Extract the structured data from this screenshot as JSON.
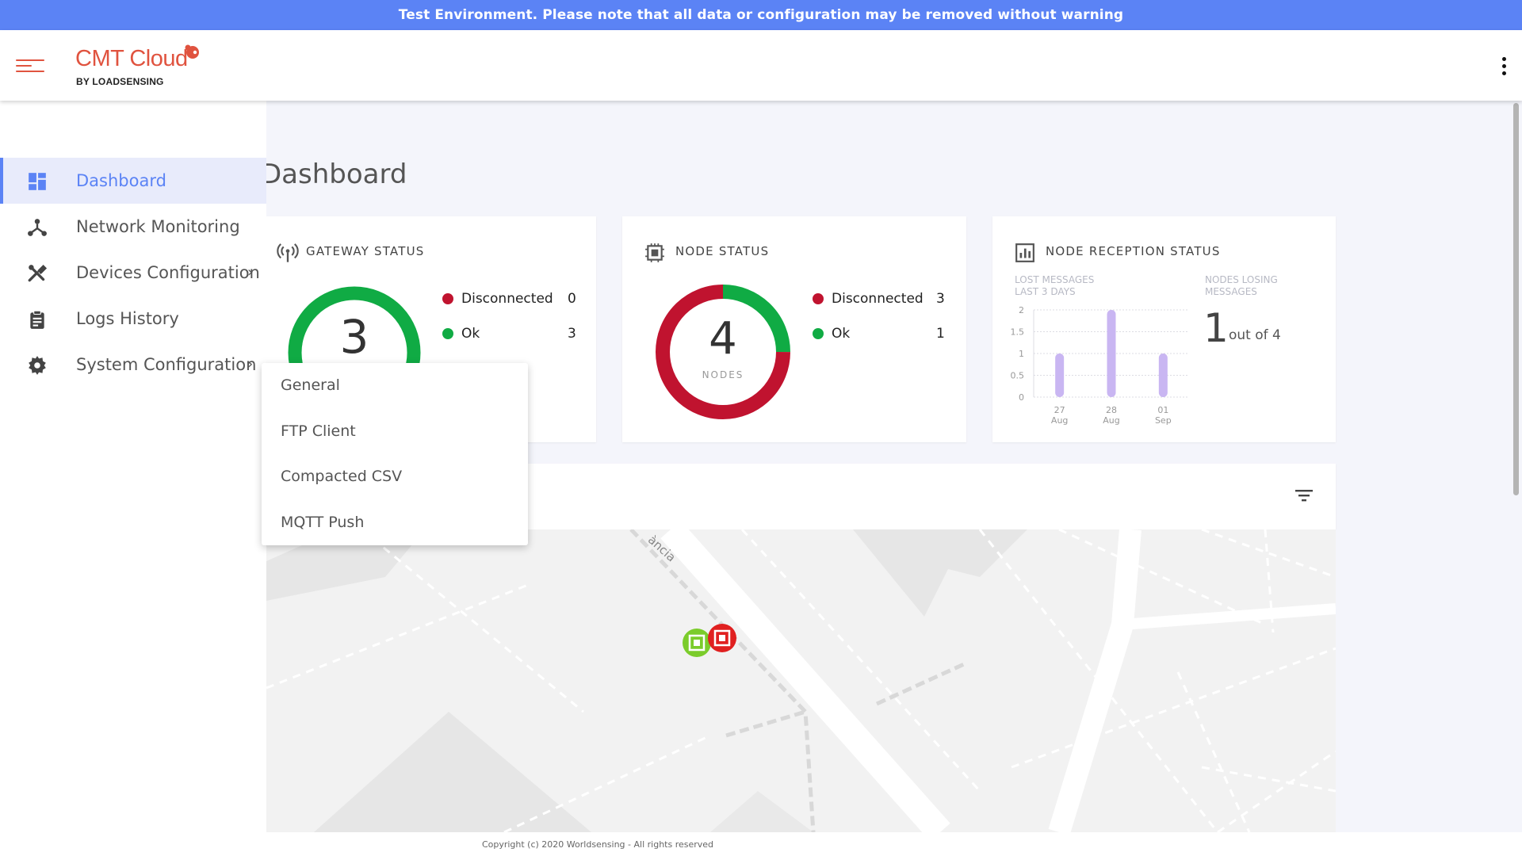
{
  "banner": {
    "text": "Test Environment. Please note that all data or configuration may be removed without warning"
  },
  "header": {
    "logo_text": "CMT Cloud",
    "logo_subtext": "BY LOADSENSING"
  },
  "sidebar": {
    "items": [
      {
        "label": "Dashboard",
        "icon": "dashboard-icon",
        "active": true
      },
      {
        "label": "Network Monitoring",
        "icon": "network-icon"
      },
      {
        "label": "Devices Configuration",
        "icon": "tools-icon",
        "has_submenu": true
      },
      {
        "label": "Logs History",
        "icon": "clipboard-icon"
      },
      {
        "label": "System Configuration",
        "icon": "gear-icon",
        "has_submenu": true
      }
    ]
  },
  "page": {
    "title": "Dashboard"
  },
  "gateway_status": {
    "title": "GATEWAY STATUS",
    "total": "3",
    "legend": [
      {
        "label": "Disconnected",
        "value": "0",
        "color": "#c0132f"
      },
      {
        "label": "Ok",
        "value": "3",
        "color": "#10ab44"
      }
    ]
  },
  "node_status": {
    "title": "NODE STATUS",
    "total": "4",
    "unit": "NODES",
    "legend": [
      {
        "label": "Disconnected",
        "value": "3",
        "color": "#c0132f"
      },
      {
        "label": "Ok",
        "value": "1",
        "color": "#10ab44"
      }
    ]
  },
  "node_reception": {
    "title": "NODE RECEPTION STATUS",
    "lost_messages_label_1": "LOST MESSAGES",
    "lost_messages_label_2": "LAST 3 DAYS",
    "nodes_losing_label_1": "NODES LOSING",
    "nodes_losing_label_2": "MESSAGES",
    "nodes_losing_value": "1",
    "nodes_losing_suffix": "out of 4"
  },
  "chart_data": {
    "type": "bar",
    "categories": [
      "27 Aug",
      "28 Aug",
      "01 Sep"
    ],
    "category_lines": [
      [
        "27",
        "Aug"
      ],
      [
        "28",
        "Aug"
      ],
      [
        "01",
        "Sep"
      ]
    ],
    "values": [
      1,
      2,
      1
    ],
    "yticks": [
      "0",
      "0.5",
      "1",
      "1.5",
      "2"
    ],
    "ylim": [
      0,
      2
    ],
    "bar_color": "#c9b6f2",
    "grid": true
  },
  "map": {
    "street_label": "ància"
  },
  "submenu": {
    "items": [
      "General",
      "FTP Client",
      "Compacted CSV",
      "MQTT Push"
    ]
  },
  "footer": {
    "text": "Copyright (c) 2020 Worldsensing - All rights reserved"
  },
  "colors": {
    "accent": "#5b83f5",
    "brand": "#e0533f",
    "ok": "#10ab44",
    "disconnected": "#c0132f"
  }
}
